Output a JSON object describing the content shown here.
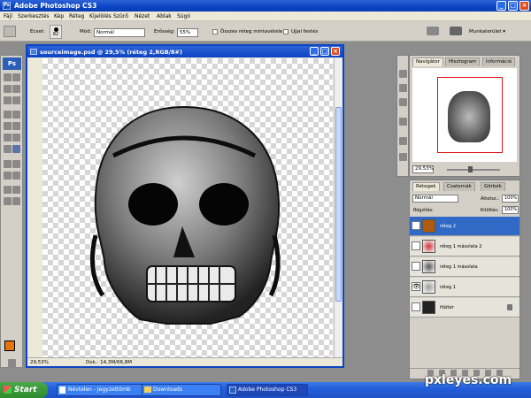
{
  "app": {
    "title": "Adobe Photoshop CS3",
    "logo": "Ps"
  },
  "menu": [
    "Fájl",
    "Szerkesztés",
    "Kép",
    "Réteg",
    "Kijelölés",
    "Szűrő",
    "Nézet",
    "Ablak",
    "Súgó"
  ],
  "options": {
    "ecset_label": "Ecset:",
    "ecset_size": "82",
    "mod_label": "Mód:",
    "mod_value": "Normál",
    "erosseg_label": "Erősség:",
    "erosseg_value": "55%",
    "all_layers_label": "Összes réteg mintavétele",
    "finger_label": "Ujjal festés",
    "workspace_label": "Munkaterület ▾"
  },
  "document": {
    "title": "sourceimage.psd @ 29,5% (réteg 2,RGB/8#)",
    "zoom": "29,53%",
    "doc_info": "Dok.: 14,3M/66,8M"
  },
  "navigator": {
    "tabs": [
      "Navigátor",
      "Hisztogram",
      "Információ"
    ],
    "zoom": "29,53%"
  },
  "layers": {
    "tabs": [
      "Rétegek",
      "Csatornák",
      "Görbék"
    ],
    "blend_mode": "Normál",
    "opacity_label": "Áttetsz.:",
    "opacity_value": "100%",
    "lock_label": "Rögzítés:",
    "fill_label": "Kitöltés:",
    "fill_value": "100%",
    "items": [
      {
        "name": "réteg 2",
        "selected": true,
        "visible": false
      },
      {
        "name": "réteg 1 másolata 2",
        "selected": false,
        "visible": false
      },
      {
        "name": "réteg 1 másolata",
        "selected": false,
        "visible": false
      },
      {
        "name": "réteg 1",
        "selected": false,
        "visible": true
      },
      {
        "name": "Háttér",
        "selected": false,
        "visible": false
      }
    ]
  },
  "taskbar": {
    "start": "Start",
    "items": [
      "Névtelen - Jegyzettömb",
      "Downloads",
      "Adobe Photoshop CS3"
    ],
    "active_index": 2
  },
  "watermark": "pxleyes.com",
  "colors": {
    "title_blue": "#0b44c4",
    "selected_layer": "#3169c6",
    "foreground": "#e8740c",
    "background": "#ffffff"
  }
}
